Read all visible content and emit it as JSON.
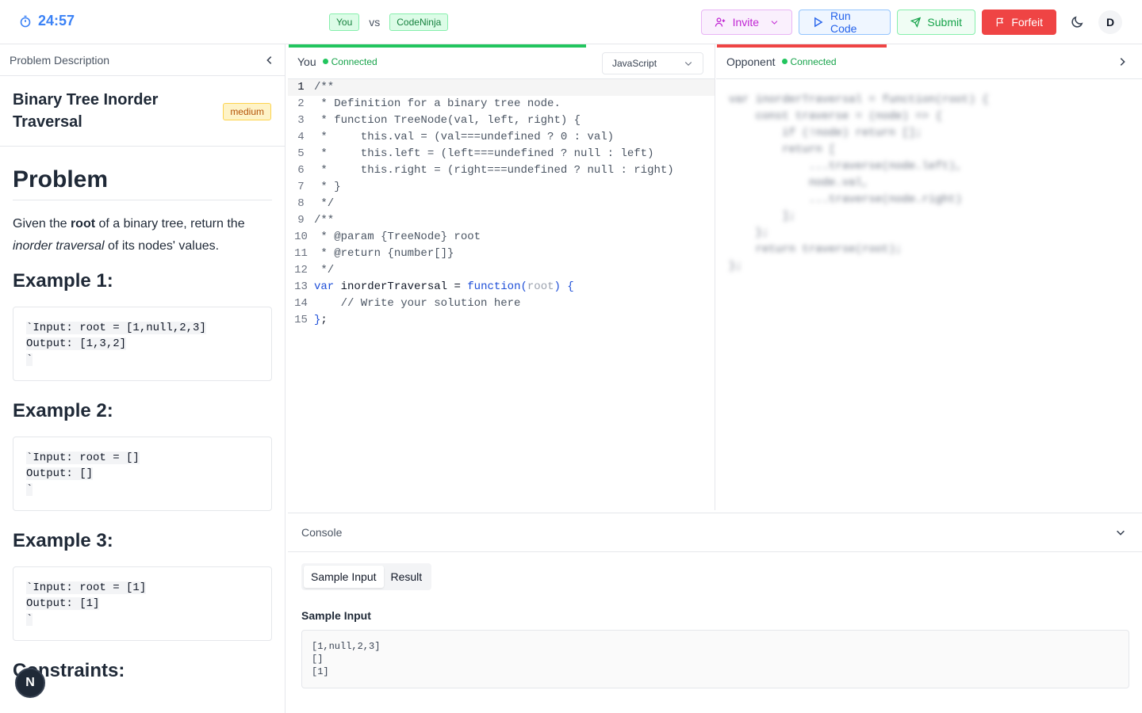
{
  "header": {
    "timer": "24:57",
    "player_you": "You",
    "vs": "vs",
    "player_opponent": "CodeNinja",
    "invite_label": "Invite",
    "run_label": "Run Code",
    "submit_label": "Submit",
    "forfeit_label": "Forfeit",
    "avatar_initial": "D"
  },
  "problem_panel": {
    "header_label": "Problem Description",
    "title": "Binary Tree Inorder Traversal",
    "difficulty": "medium",
    "heading": "Problem",
    "statement_pre": "Given the ",
    "statement_bold": "root",
    "statement_mid": " of a binary tree, return the ",
    "statement_italic": "inorder traversal",
    "statement_post": " of its nodes' values.",
    "examples": [
      {
        "heading": "Example 1:",
        "input": "Input: root = [1,null,2,3]",
        "output": "Output: [1,3,2]"
      },
      {
        "heading": "Example 2:",
        "input": "Input: root = []",
        "output": "Output: []"
      },
      {
        "heading": "Example 3:",
        "input": "Input: root = [1]",
        "output": "Output: [1]"
      }
    ],
    "constraints_heading": "Constraints:"
  },
  "editor": {
    "player_label": "You",
    "status": "Connected",
    "language": "JavaScript",
    "lines": [
      "/**",
      " * Definition for a binary tree node.",
      " * function TreeNode(val, left, right) {",
      " *     this.val = (val===undefined ? 0 : val)",
      " *     this.left = (left===undefined ? null : left)",
      " *     this.right = (right===undefined ? null : right)",
      " * }",
      " */",
      "/**",
      " * @param {TreeNode} root",
      " * @return {number[]}",
      " */",
      "var inorderTraversal = function(root) {",
      "    // Write your solution here",
      "};"
    ]
  },
  "opponent": {
    "label": "Opponent",
    "status": "Connected",
    "code": "var inorderTraversal = function(root) {\n    const traverse = (node) => {\n        if (!node) return [];\n        return [\n            ...traverse(node.left),\n            node.val,\n            ...traverse(node.right)\n        ];\n    };\n    return traverse(root);\n};"
  },
  "console": {
    "title": "Console",
    "tabs": [
      "Sample Input",
      "Result"
    ],
    "sample_label": "Sample Input",
    "sample_value": "[1,null,2,3]\n[]\n[1]"
  },
  "badge": {
    "letter": "N"
  },
  "colors": {
    "accent_blue": "#3b82f6",
    "success_green": "#22c55e",
    "danger_red": "#ef4444",
    "invite_purple": "#c026d3",
    "difficulty_amber": "#b45309"
  }
}
